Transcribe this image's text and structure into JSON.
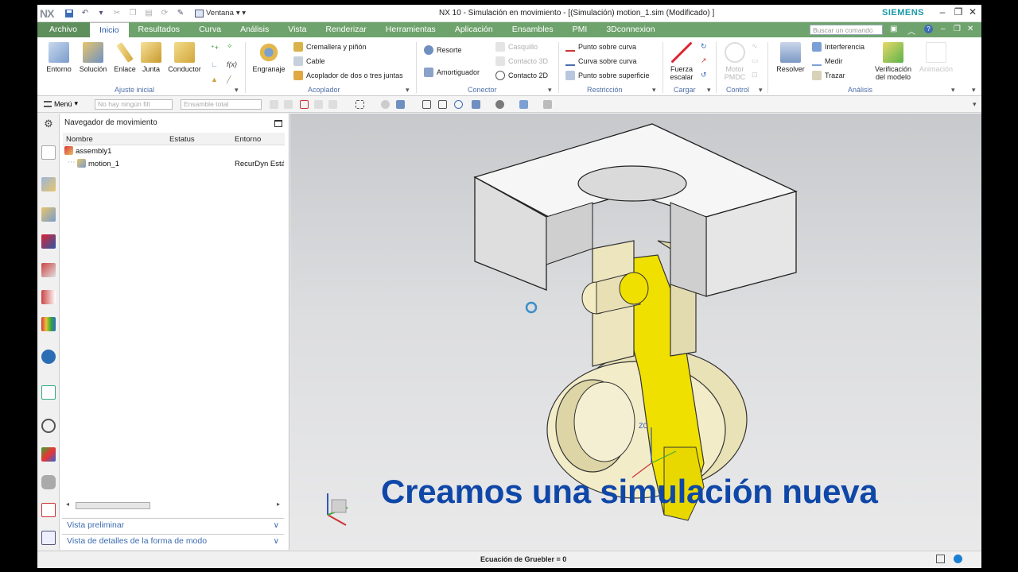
{
  "app": {
    "logo": "NX",
    "window_menu": "Ventana",
    "title": "NX 10 - Simulación en movimiento - [(Simulación) motion_1.sim (Modificado) ]",
    "brand": "SIEMENS"
  },
  "tabs": [
    "Archivo",
    "Inicio",
    "Resultados",
    "Curva",
    "Análisis",
    "Vista",
    "Renderizar",
    "Herramientas",
    "Aplicación",
    "Ensambles",
    "PMI",
    "3Dconnexion"
  ],
  "search": {
    "placeholder": "Buscar un comando"
  },
  "ribbon": {
    "ajuste": {
      "label": "Ajuste inicial",
      "buttons": [
        "Entorno",
        "Solución",
        "Enlace",
        "Junta",
        "Conductor"
      ]
    },
    "acoplador": {
      "label": "Acoplador",
      "big": "Engranaje",
      "items": [
        "Cremallera y piñón",
        "Cable",
        "Acoplador de dos o tres juntas"
      ]
    },
    "conector": {
      "label": "Conector",
      "items": [
        "Resorte",
        "Amortiguador",
        "Casquillo",
        "Contacto 3D",
        "Contacto 2D"
      ]
    },
    "restriccion": {
      "label": "Restricción",
      "items": [
        "Punto sobre curva",
        "Curva sobre curva",
        "Punto sobre superficie"
      ]
    },
    "cargar": {
      "label": "Cargar",
      "big": "Fuerza escalar"
    },
    "control": {
      "label": "Control",
      "big": "Motor PMDC"
    },
    "analisis": {
      "label": "Análisis",
      "resolver": "Resolver",
      "items": [
        "Interferencia",
        "Medir",
        "Trazar"
      ],
      "verificacion": "Verificación del modelo",
      "animacion": "Animación"
    }
  },
  "cmdbar": {
    "menu": "Menú",
    "filter": "No hay ningún filt",
    "scope": "Ensamble total"
  },
  "navigator": {
    "title": "Navegador de movimiento",
    "columns": [
      "Nombre",
      "Estatus",
      "Entorno"
    ],
    "rows": [
      {
        "name": "assembly1",
        "status": "",
        "env": ""
      },
      {
        "name": "motion_1",
        "status": "",
        "env": "RecurDyn Estático"
      }
    ],
    "accordions": [
      "Vista preliminar",
      "Vista de detalles de la forma de modo"
    ]
  },
  "viewport": {
    "caption": "Creamos una simulación nueva",
    "triad_label": "ZC"
  },
  "status": {
    "text": "Ecuación de Gruebler = 0"
  },
  "colors": {
    "ribbon_green": "#6fa36d",
    "caption_blue": "#0f47a8",
    "part_yellow": "#f0e000",
    "part_cream": "#efe9c3"
  }
}
